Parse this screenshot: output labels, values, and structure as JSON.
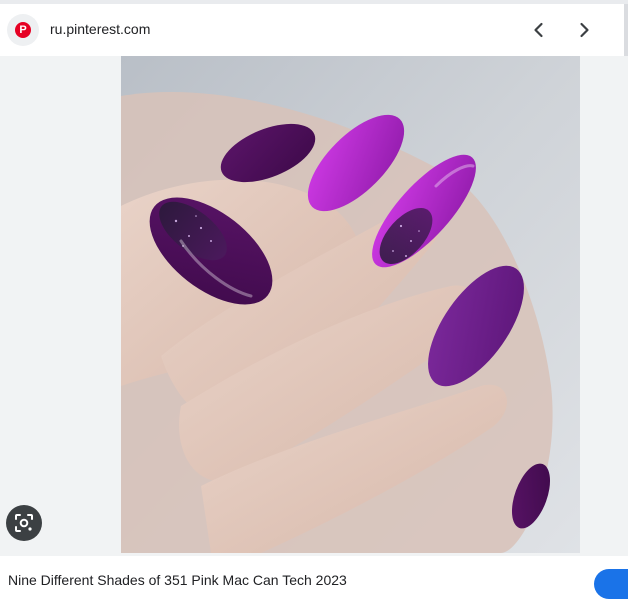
{
  "source": {
    "domain": "ru.pinterest.com",
    "favicon_letter": "P",
    "favicon_icon": "pinterest-logo-icon",
    "brand_color": "#e60023"
  },
  "navigation": {
    "prev_icon": "chevron-left-icon",
    "next_icon": "chevron-right-icon"
  },
  "image": {
    "subject": "photo of a hand with long almond-shaped purple manicured nails",
    "colors": [
      "#4a0f57",
      "#b71fd6",
      "#7a1f9c"
    ]
  },
  "lens": {
    "icon": "lens-search-icon"
  },
  "caption": {
    "text": "Nine Different Shades of 351 Pink Mac Can Tech 2023"
  },
  "visit_button": {
    "color": "#1a73e8"
  }
}
